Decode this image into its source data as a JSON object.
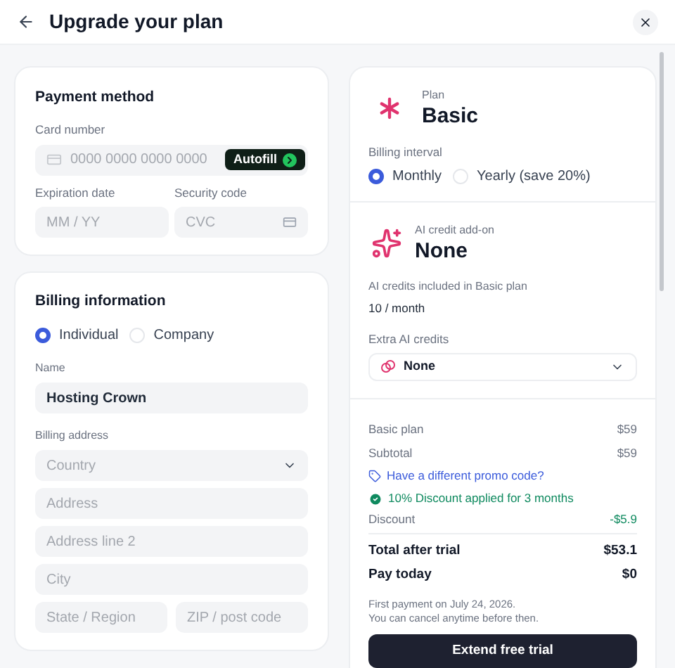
{
  "header": {
    "title": "Upgrade your plan"
  },
  "payment": {
    "title": "Payment method",
    "card_label": "Card number",
    "card_placeholder": "0000 0000 0000 0000",
    "autofill": "Autofill",
    "exp_label": "Expiration date",
    "exp_placeholder": "MM / YY",
    "cvc_label": "Security code",
    "cvc_placeholder": "CVC"
  },
  "billing": {
    "title": "Billing information",
    "types": [
      {
        "label": "Individual",
        "selected": true
      },
      {
        "label": "Company",
        "selected": false
      }
    ],
    "name_label": "Name",
    "name_value": "Hosting Crown",
    "address_label": "Billing address",
    "fields": [
      {
        "kind": "select",
        "placeholder": "Country"
      },
      {
        "kind": "text",
        "placeholder": "Address"
      },
      {
        "kind": "text",
        "placeholder": "Address line 2"
      },
      {
        "kind": "text",
        "placeholder": "City"
      }
    ],
    "split_fields": [
      {
        "placeholder": "State / Region"
      },
      {
        "placeholder": "ZIP / post code"
      }
    ]
  },
  "plan": {
    "caption": "Plan",
    "name": "Basic",
    "interval_label": "Billing interval",
    "intervals": [
      {
        "label": "Monthly",
        "selected": true
      },
      {
        "label": "Yearly (save 20%)",
        "selected": false
      }
    ]
  },
  "addon": {
    "caption": "AI credit add-on",
    "name": "None",
    "included_label": "AI credits included in Basic plan",
    "included_value": "10 / month",
    "extra_label": "Extra AI credits",
    "extra_value": "None"
  },
  "summary": {
    "lines": [
      {
        "label": "Basic plan",
        "value": "$59"
      },
      {
        "label": "Subtotal",
        "value": "$59"
      }
    ],
    "promo_link": "Have a different promo code?",
    "discount_note": "10% Discount applied for 3 months",
    "discount": {
      "label": "Discount",
      "value": "-$5.9"
    },
    "totals": [
      {
        "label": "Total after trial",
        "value": "$53.1"
      },
      {
        "label": "Pay today",
        "value": "$0"
      }
    ],
    "note_lines": [
      "First payment on July 24, 2026.",
      "You can cancel anytime before then."
    ],
    "cta": "Extend free trial"
  }
}
